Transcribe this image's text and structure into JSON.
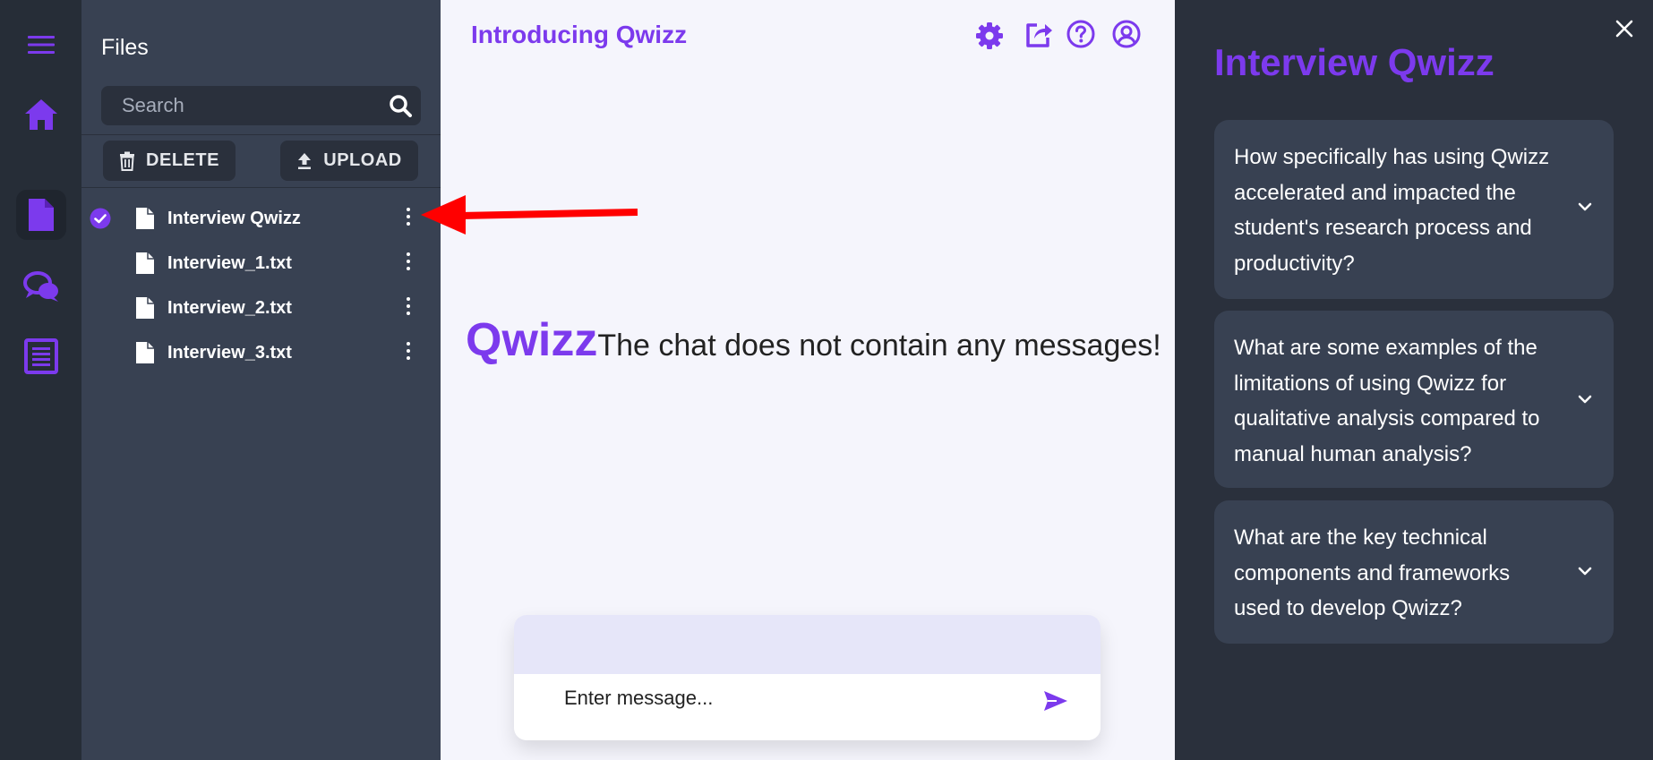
{
  "rail": {
    "items": [
      {
        "icon": "menu-icon"
      },
      {
        "icon": "home-icon"
      },
      {
        "icon": "document-icon",
        "active": true
      },
      {
        "icon": "chat-icon"
      },
      {
        "icon": "notes-icon"
      }
    ]
  },
  "files": {
    "title": "Files",
    "search_placeholder": "Search",
    "delete_label": "DELETE",
    "upload_label": "UPLOAD",
    "items": [
      {
        "name": "Interview Qwizz",
        "selected": true
      },
      {
        "name": "Interview_1.txt",
        "selected": false
      },
      {
        "name": "Interview_2.txt",
        "selected": false
      },
      {
        "name": "Interview_3.txt",
        "selected": false
      }
    ]
  },
  "main": {
    "title": "Introducing Qwizz",
    "toolbar": [
      "settings-icon",
      "share-icon",
      "help-icon",
      "account-icon"
    ],
    "empty_logo": "Qwizz",
    "empty_text": "The chat does not contain any messages!",
    "composer_placeholder": "Enter message..."
  },
  "right": {
    "title": "Interview Qwizz",
    "questions": [
      "How specifically has using Qwizz accelerated and impacted the student's research process and productivity?",
      "What are some examples of the limitations of using Qwizz for qualitative analysis compared to manual human analysis?",
      "What are the key technical components and frameworks used to develop Qwizz?"
    ]
  },
  "colors": {
    "accent": "#7c3aed",
    "rail_bg": "#262d37",
    "panel_bg": "#384152",
    "dark_bg": "#2a303c",
    "main_bg": "#f5f5fc",
    "annotation_arrow": "#ff0000"
  }
}
